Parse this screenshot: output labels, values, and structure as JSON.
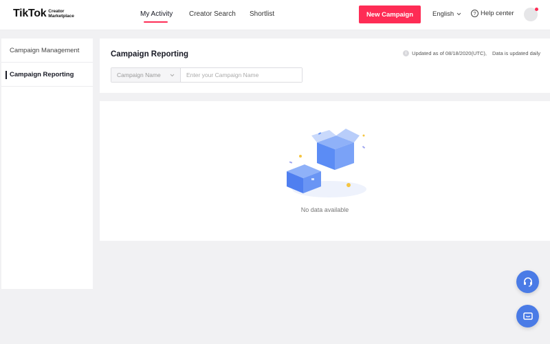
{
  "brand": {
    "name": "TikTok",
    "sub_line1": "Creator",
    "sub_line2": "Marketplace"
  },
  "nav": [
    {
      "label": "My Activity",
      "active": true
    },
    {
      "label": "Creator Search",
      "active": false
    },
    {
      "label": "Shortlist",
      "active": false
    }
  ],
  "header_actions": {
    "new_campaign_label": "New Campaign",
    "language_label": "English",
    "help_label": "Help center"
  },
  "sidebar": {
    "items": [
      {
        "label": "Campaign Management",
        "active": false
      },
      {
        "label": "Campaign Reporting",
        "active": true
      }
    ]
  },
  "page": {
    "title": "Campaign Reporting",
    "updated_text": "Updated as of 08/18/2020(UTC),",
    "updated_note": "Data is updated daily",
    "search_type": "Campaign Name",
    "search_placeholder": "Enter your Campaign Name",
    "empty_text": "No data available"
  },
  "colors": {
    "accent": "#fe2c55",
    "fab": "#4a7be6",
    "box": "#5b8cf5"
  },
  "icons": {
    "help": "help-icon",
    "info": "info-icon",
    "support": "headset-icon",
    "chat": "chat-icon"
  }
}
